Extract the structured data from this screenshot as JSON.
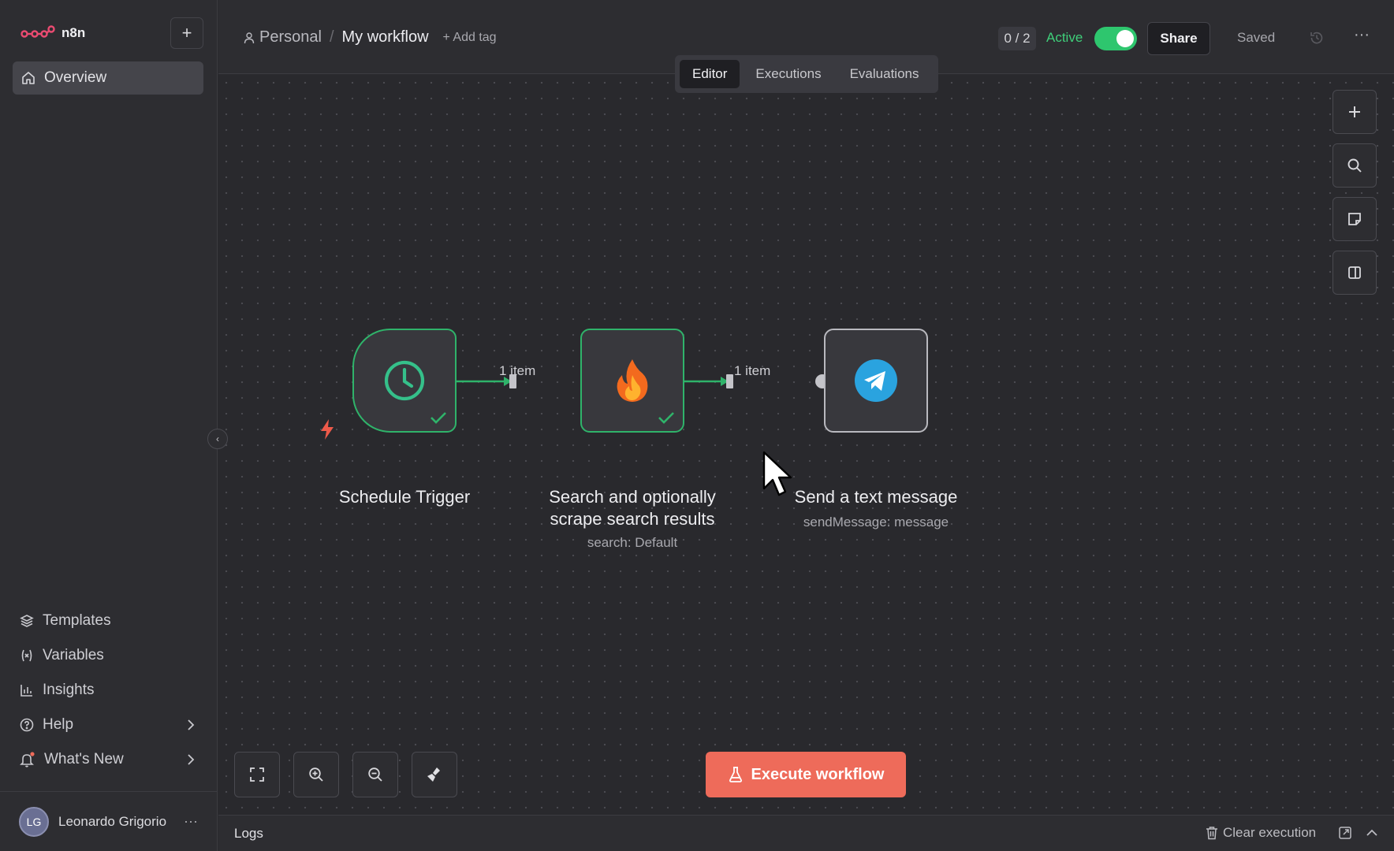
{
  "brand": {
    "name": "n8n"
  },
  "sidebar": {
    "overview_label": "Overview",
    "bottom_items": [
      {
        "label": "Templates",
        "icon": "templates-icon"
      },
      {
        "label": "Variables",
        "icon": "variables-icon"
      },
      {
        "label": "Insights",
        "icon": "insights-icon"
      },
      {
        "label": "Help",
        "icon": "help-icon"
      },
      {
        "label": "What's New",
        "icon": "bell-icon"
      }
    ],
    "user": {
      "initials": "LG",
      "name": "Leonardo Grigorio"
    }
  },
  "header": {
    "project": "Personal",
    "workflow_title": "My workflow",
    "add_tag": "+ Add tag",
    "counter": "0 / 2",
    "active_label": "Active",
    "active": true,
    "share_label": "Share",
    "saved_label": "Saved"
  },
  "tabs": [
    "Editor",
    "Executions",
    "Evaluations"
  ],
  "active_tab": "Editor",
  "canvas": {
    "nodes": [
      {
        "name": "Schedule Trigger",
        "subtitle": "",
        "status": "success"
      },
      {
        "name_line1": "Search and optionally",
        "name_line2": "scrape search results",
        "subtitle": "search: Default",
        "status": "success"
      },
      {
        "name": "Send a text message",
        "subtitle": "sendMessage: message",
        "status": "idle"
      }
    ],
    "edges": [
      {
        "label": "1 item"
      },
      {
        "label": "1 item"
      }
    ]
  },
  "execute_label": "Execute workflow",
  "logs": {
    "title": "Logs",
    "clear_label": "Clear execution"
  },
  "colors": {
    "accent_red": "#ee6b5a",
    "success_green": "#2fb36a",
    "active_green": "#3fcf7a",
    "telegram_blue": "#2aa3df"
  }
}
